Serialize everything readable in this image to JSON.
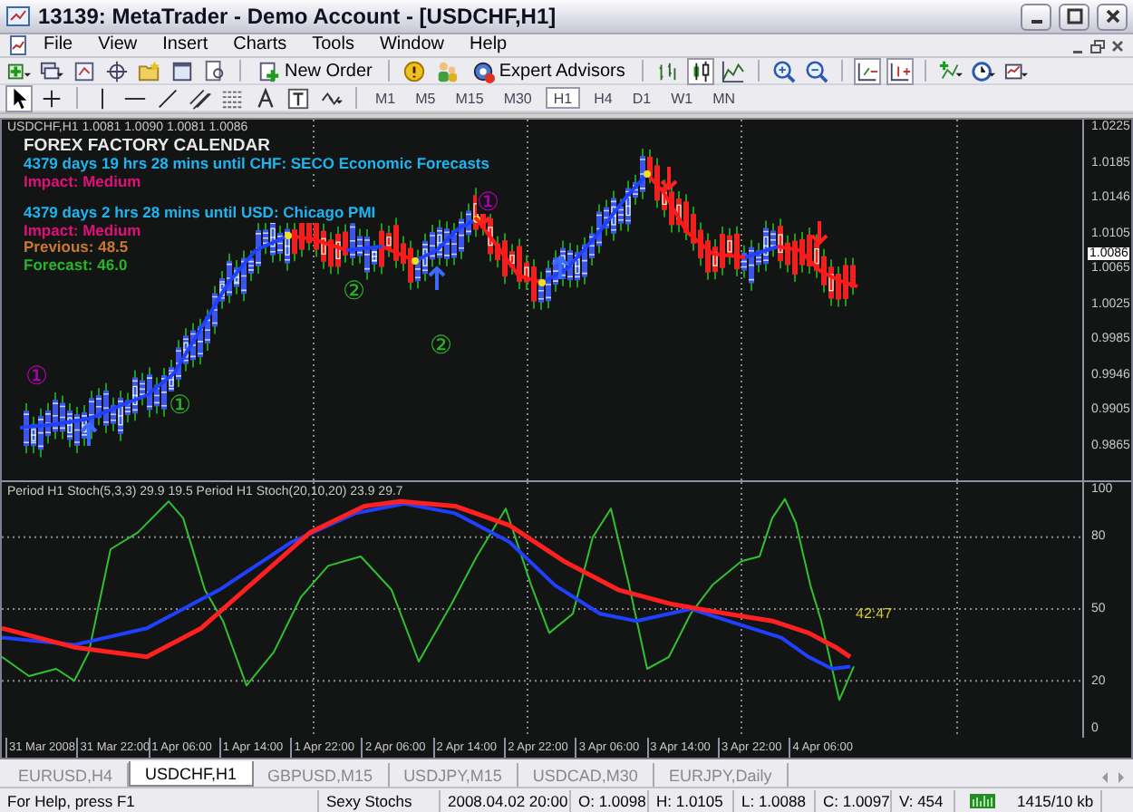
{
  "window": {
    "title": "13139: MetaTrader - Demo Account - [USDCHF,H1]"
  },
  "menu": [
    "File",
    "View",
    "Insert",
    "Charts",
    "Tools",
    "Window",
    "Help"
  ],
  "toolbar": {
    "new_order": "New Order",
    "expert_advisors": "Expert Advisors"
  },
  "periods": [
    {
      "label": "M1",
      "selected": false
    },
    {
      "label": "M5",
      "selected": false
    },
    {
      "label": "M15",
      "selected": false
    },
    {
      "label": "M30",
      "selected": false
    },
    {
      "label": "H1",
      "selected": true
    },
    {
      "label": "H4",
      "selected": false
    },
    {
      "label": "D1",
      "selected": false
    },
    {
      "label": "W1",
      "selected": false
    },
    {
      "label": "MN",
      "selected": false
    }
  ],
  "chart": {
    "header": "USDCHF,H1  1.0081 1.0090 1.0081 1.0086",
    "calendar_title": "FOREX FACTORY CALENDAR",
    "calendar": [
      {
        "text": "4379 days 19 hrs 28 mins until CHF: SECO Economic Forecasts",
        "color": "#1eb4f0",
        "gap_before": false
      },
      {
        "text": "Impact: Medium",
        "color": "#e0107a",
        "gap_before": false
      },
      {
        "text": "4379 days 2 hrs 28 mins until USD: Chicago PMI",
        "color": "#1eb4f0",
        "gap_before": true
      },
      {
        "text": "Impact: Medium",
        "color": "#e0107a",
        "gap_before": false
      },
      {
        "text": "Previous: 48.5",
        "color": "#c87832",
        "gap_before": false
      },
      {
        "text": "Forecast: 46.0",
        "color": "#28b428",
        "gap_before": false
      }
    ],
    "markers": [
      {
        "label": "①",
        "color": "#b400b4"
      },
      {
        "label": "①",
        "color": "#28b428"
      },
      {
        "label": "②",
        "color": "#28b428"
      },
      {
        "label": "②",
        "color": "#28b428"
      },
      {
        "label": "①",
        "color": "#b400b4"
      }
    ],
    "price_axis": [
      {
        "label": "1.0225",
        "current": false
      },
      {
        "label": "1.0185",
        "current": false
      },
      {
        "label": "1.0146",
        "current": false
      },
      {
        "label": "1.0105",
        "current": false
      },
      {
        "label": "1.0086",
        "current": true
      },
      {
        "label": "1.0065",
        "current": false
      },
      {
        "label": "1.0025",
        "current": false
      },
      {
        "label": "0.9985",
        "current": false
      },
      {
        "label": "0.9946",
        "current": false
      },
      {
        "label": "0.9905",
        "current": false
      },
      {
        "label": "0.9865",
        "current": false
      }
    ],
    "indicator_label": "Period H1 Stoch(5,3,3) 29.9 19.5  Period H1 Stoch(20,10,20) 23.9 29.7",
    "indicator_reading": "42:47",
    "indicator_axis": [
      "100",
      "80",
      "50",
      "20",
      "0"
    ],
    "time_axis": [
      "31 Mar 2008",
      "31 Mar 22:00",
      "1 Apr 06:00",
      "1 Apr 14:00",
      "1 Apr 22:00",
      "2 Apr 06:00",
      "2 Apr 14:00",
      "2 Apr 22:00",
      "3 Apr 06:00",
      "3 Apr 14:00",
      "3 Apr 22:00",
      "4 Apr 06:00"
    ]
  },
  "tabs": [
    {
      "label": "EURUSD,H4",
      "selected": false
    },
    {
      "label": "USDCHF,H1",
      "selected": true
    },
    {
      "label": "GBPUSD,M15",
      "selected": false
    },
    {
      "label": "USDJPY,M15",
      "selected": false
    },
    {
      "label": "USDCAD,M30",
      "selected": false
    },
    {
      "label": "EURJPY,Daily",
      "selected": false
    }
  ],
  "status_bar": [
    "For Help, press F1",
    "Sexy Stochs",
    "2008.04.02 20:00",
    "O: 1.0098",
    "H: 1.0105",
    "L: 1.0088",
    "C: 1.0097",
    "V: 454",
    "1415/10 kb"
  ]
}
